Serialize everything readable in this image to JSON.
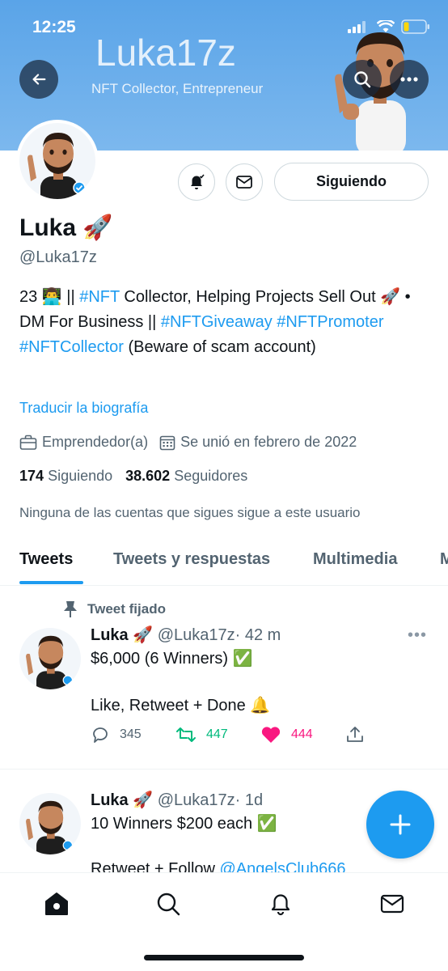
{
  "status_bar": {
    "time": "12:25"
  },
  "banner": {
    "title": "Luka17z",
    "subtitle": "NFT Collector, Entrepreneur"
  },
  "profile": {
    "follow_button": "Siguiendo",
    "name": "Luka 🚀",
    "handle": "@Luka17z",
    "bio": {
      "p1": "23 👨‍💻 || ",
      "tag1": "#NFT",
      "p2": " Collector, Helping Projects Sell Out 🚀 • DM For Business || ",
      "tag2": "#NFTGiveaway",
      "tag3": "#NFTPromoter",
      "tag4": "#NFTCollector",
      "p3": "   (Beware of scam account)"
    },
    "translate_link": "Traducir la biografía",
    "occupation": "Emprendedor(a)",
    "joined": "Se unió en febrero de 2022",
    "following_count": "174",
    "following_label": "Siguiendo",
    "followers_count": "38.602",
    "followers_label": "Seguidores",
    "followers_you_know": "Ninguna de las cuentas que sigues sigue a este usuario"
  },
  "tabs": [
    {
      "label": "Tweets"
    },
    {
      "label": "Tweets y respuestas"
    },
    {
      "label": "Multimedia"
    },
    {
      "label": "M"
    }
  ],
  "tweets": [
    {
      "pinned_label": "Tweet fijado",
      "name": "Luka 🚀",
      "handle": "@Luka17z",
      "time": "· 42 m",
      "line1": "$6,000 (6 Winners) ✅",
      "line2": "Like, Retweet + Done 🔔",
      "replies": "345",
      "retweets": "447",
      "likes": "444"
    },
    {
      "name": "Luka 🚀",
      "handle": "@Luka17z",
      "time": "· 1d",
      "line1": "10 Winners $200 each ✅",
      "line2": "Retweet + Follow ",
      "mention": "@AngelsClub666"
    }
  ],
  "colors": {
    "accent": "#1d9bf0",
    "retweet": "#00ba7c",
    "like": "#f91880",
    "banner": "#5aa4e8"
  },
  "icons": [
    "back-arrow-icon",
    "search-icon",
    "more-icon",
    "bell-icon",
    "mail-icon",
    "briefcase-icon",
    "calendar-icon",
    "pin-icon",
    "reply-icon",
    "retweet-icon",
    "heart-icon",
    "share-icon",
    "plus-icon",
    "home-icon"
  ]
}
